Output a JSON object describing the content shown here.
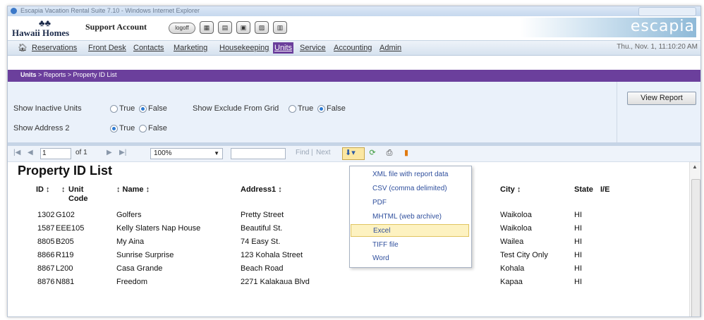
{
  "window": {
    "title": "Escapia Vacation Rental Suite 7.10 - Windows Internet Explorer"
  },
  "header": {
    "logo_text": "Hawaii Homes",
    "account": "Support Account",
    "logoff_label": "logoff",
    "brand": "escapia"
  },
  "nav": {
    "items": [
      "Reservations",
      "Front Desk",
      "Contacts",
      "Marketing",
      "Housekeeping",
      "Units",
      "Service",
      "Accounting",
      "Admin"
    ],
    "active": "Units",
    "datetime": "Thu., Nov. 1, 11:10:20 AM"
  },
  "breadcrumb": {
    "root": "Units",
    "rest": " > Reports > Property ID List"
  },
  "params": {
    "inactive_label": "Show Inactive Units",
    "exclude_label": "Show Exclude From Grid",
    "address2_label": "Show Address 2",
    "true_label": "True",
    "false_label": "False",
    "inactive_value": "False",
    "exclude_value": "False",
    "address2_value": "True",
    "view_report": "View Report"
  },
  "toolbar": {
    "page": "1",
    "of_pages": "of 1",
    "zoom": "100%",
    "find_label": "Find",
    "separator": "|",
    "next_label": "Next"
  },
  "export_menu": {
    "items": [
      "XML file with report data",
      "CSV (comma delimited)",
      "PDF",
      "MHTML (web archive)",
      "Excel",
      "TIFF file",
      "Word"
    ],
    "highlighted": "Excel"
  },
  "report": {
    "title": "Property ID List",
    "columns": {
      "id": "ID ↕",
      "unit_code_1": "Unit",
      "unit_code_sort": "↕",
      "unit_code_2": "Code",
      "name": "↕ Name ↕",
      "address1": "Address1 ↕",
      "city": "City ↕",
      "state": "State",
      "ie": "I/E"
    },
    "rows": [
      {
        "id": "1302",
        "unit": "G102",
        "name": "Golfers",
        "address": "Pretty Street",
        "city": "Waikoloa",
        "state": "HI"
      },
      {
        "id": "1587",
        "unit": "EEE105",
        "name": "Kelly Slaters Nap House",
        "address": "Beautiful St.",
        "city": "Waikoloa",
        "state": "HI"
      },
      {
        "id": "8805",
        "unit": "B205",
        "name": "My Aina",
        "address": "74 Easy St.",
        "city": "Wailea",
        "state": "HI"
      },
      {
        "id": "8866",
        "unit": "R119",
        "name": "Sunrise Surprise",
        "address": "123 Kohala Street",
        "city": "Test City Only",
        "state": "HI"
      },
      {
        "id": "8867",
        "unit": "L200",
        "name": "Casa Grande",
        "address": "Beach Road",
        "city": "Kohala",
        "state": "HI"
      },
      {
        "id": "8876",
        "unit": "N881",
        "name": "Freedom",
        "address": "2271 Kalakaua Blvd",
        "city": "Kapaa",
        "state": "HI"
      }
    ]
  },
  "colors": {
    "accent_purple": "#6b3f9c",
    "menu_highlight": "#fdf2c1",
    "param_bg": "#eaf1fa"
  }
}
